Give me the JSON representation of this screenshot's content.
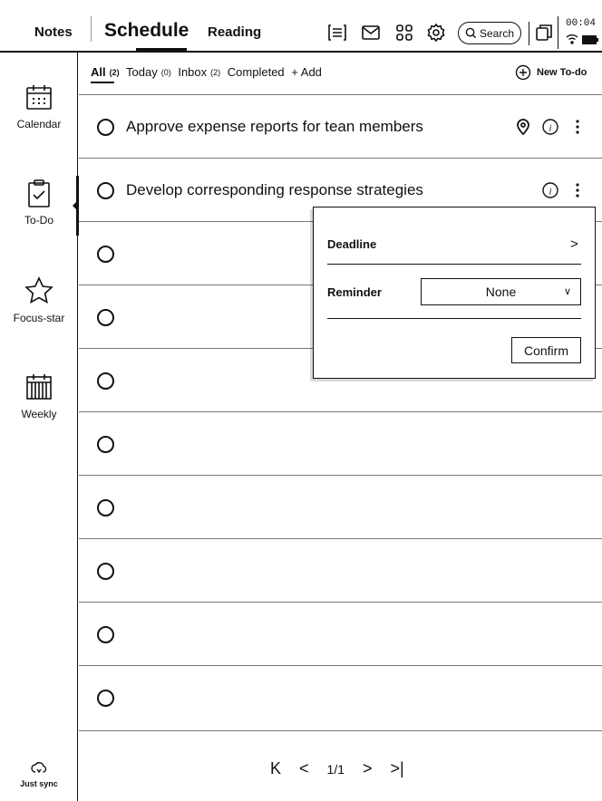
{
  "top_tabs": {
    "notes": "Notes",
    "schedule": "Schedule",
    "reading": "Reading"
  },
  "toolbar": {
    "search_label": "Search"
  },
  "status": {
    "time": "00:04"
  },
  "sidebar": {
    "items": [
      {
        "label": "Calendar"
      },
      {
        "label": "To-Do"
      },
      {
        "label": "Focus-star"
      },
      {
        "label": "Weekly"
      }
    ],
    "sync_label": "Just sync"
  },
  "filters": {
    "all": "All",
    "all_count": "(2)",
    "today": "Today",
    "today_count": "(0)",
    "inbox": "Inbox",
    "inbox_count": "(2)",
    "completed": "Completed",
    "add": "+ Add",
    "new_todo": "New To-do"
  },
  "todos": [
    {
      "text": "Approve expense reports for tean members"
    },
    {
      "text": "Develop corresponding response strategies"
    }
  ],
  "popup": {
    "deadline_label": "Deadline",
    "reminder_label": "Reminder",
    "reminder_value": "None",
    "confirm_label": "Confirm"
  },
  "pager": {
    "page_text": "1/1"
  }
}
